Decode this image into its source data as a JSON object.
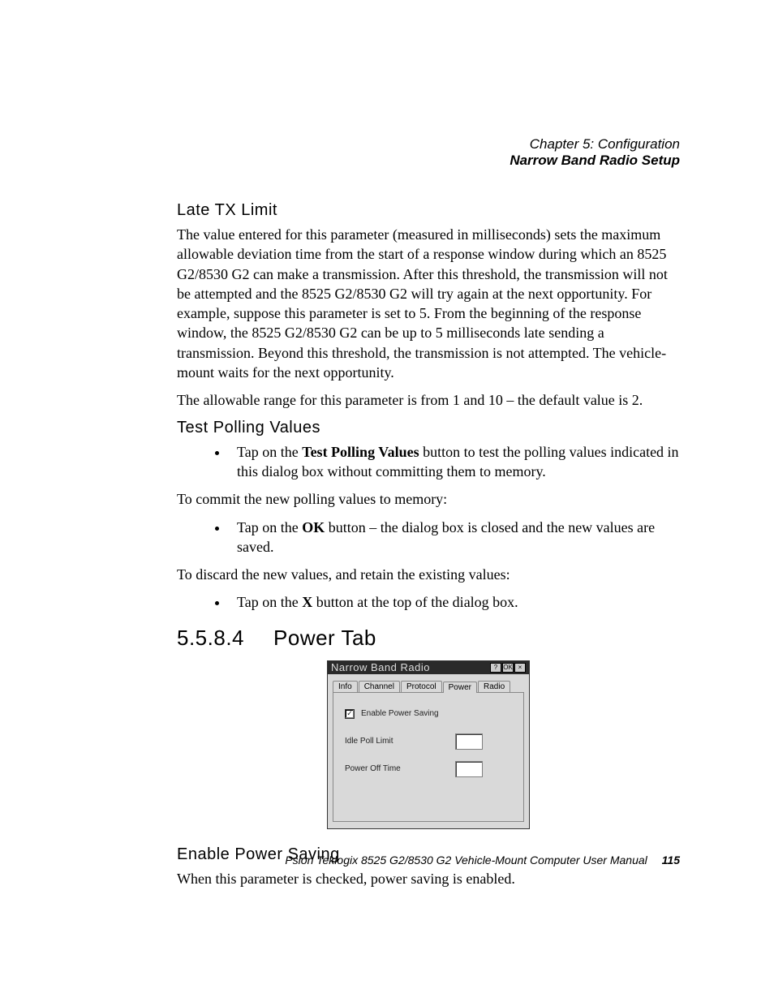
{
  "header": {
    "chapter": "Chapter 5: Configuration",
    "section": "Narrow Band Radio Setup"
  },
  "late_tx": {
    "heading": "Late TX Limit",
    "p1": "The value entered for this parameter (measured in milliseconds) sets the maximum allowable deviation time from the start of a response window during which an 8525 G2/8530 G2 can make a transmission. After this threshold, the transmission will not be attempted and the 8525 G2/8530 G2 will try again at the next opportunity. For example, suppose this parameter is set to 5. From the beginning of the response window, the 8525 G2/8530 G2 can be up to 5 milliseconds late sending a transmission. Beyond this threshold, the transmission is not attempted. The vehicle-mount waits for the next opportunity.",
    "p2": "The allowable range for this parameter is from 1 and 10 – the default value is 2."
  },
  "test_polling": {
    "heading": "Test Polling Values",
    "b1_pre": "Tap on the ",
    "b1_bold": "Test Polling Values",
    "b1_post": " button to test the polling values indicated in this dialog box without committing them to memory.",
    "p_commit": "To commit the new polling values to memory:",
    "b2_pre": "Tap on the ",
    "b2_bold": "OK",
    "b2_post": " button – the dialog box is closed and the new values are saved.",
    "p_discard": "To discard the new values, and retain the existing values:",
    "b3_pre": "Tap on the ",
    "b3_bold": "X",
    "b3_post": " button at the top of the dialog box."
  },
  "power_tab": {
    "number": "5.5.8.4",
    "title": "Power Tab"
  },
  "dialog": {
    "title": "Narrow Band Radio",
    "btn_help": "?",
    "btn_ok": "OK",
    "btn_close": "×",
    "tabs": [
      "Info",
      "Channel",
      "Protocol",
      "Power",
      "Radio"
    ],
    "active_tab": "Power",
    "enable_label": "Enable Power Saving",
    "enable_checked": true,
    "checkmark": "✓",
    "idle_label": "Idle Poll Limit",
    "idle_value": "",
    "power_off_label": "Power Off Time",
    "power_off_value": ""
  },
  "enable_ps": {
    "heading": "Enable Power Saving",
    "p1": "When this parameter is checked, power saving is enabled."
  },
  "footer": {
    "text": "Psion Teklogix 8525 G2/8530 G2 Vehicle-Mount Computer User Manual",
    "page": "115"
  }
}
